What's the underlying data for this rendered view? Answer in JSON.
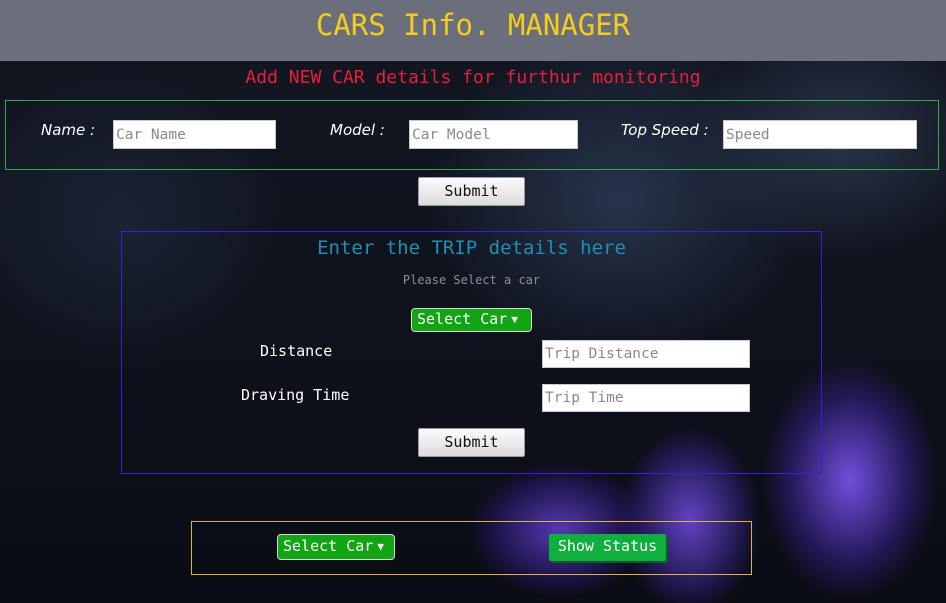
{
  "app": {
    "title": "CARS Info. MANAGER"
  },
  "add_car": {
    "heading": "Add NEW CAR details for furthur monitoring",
    "name_label": "Name :",
    "name_placeholder": "Car Name",
    "name_value": "",
    "model_label": "Model :",
    "model_placeholder": "Car Model",
    "model_value": "",
    "speed_label": "Top Speed :",
    "speed_placeholder": "Speed",
    "speed_value": "",
    "submit_label": "Submit"
  },
  "trip": {
    "heading": "Enter the TRIP details here",
    "hint": "Please Select a car",
    "select_label": "Select Car",
    "select_arrow": "▼",
    "distance_label": "Distance",
    "distance_placeholder": "Trip Distance",
    "distance_value": "",
    "time_label": "Draving Time",
    "time_placeholder": "Trip Time",
    "time_value": "",
    "submit_label": "Submit"
  },
  "status": {
    "select_label": "Select Car",
    "select_arrow": "▼",
    "button_label": "Show Status"
  },
  "colors": {
    "header_bg": "#6b6e7b",
    "title": "#f5cb1d",
    "add_heading": "#ea1e3a",
    "add_border": "#2fa84a",
    "trip_border": "#3a1fd8",
    "trip_heading": "#1f8fb3",
    "status_border": "#e1b13c",
    "select_bg": "#11a514",
    "status_button_bg": "#0fae3f"
  }
}
